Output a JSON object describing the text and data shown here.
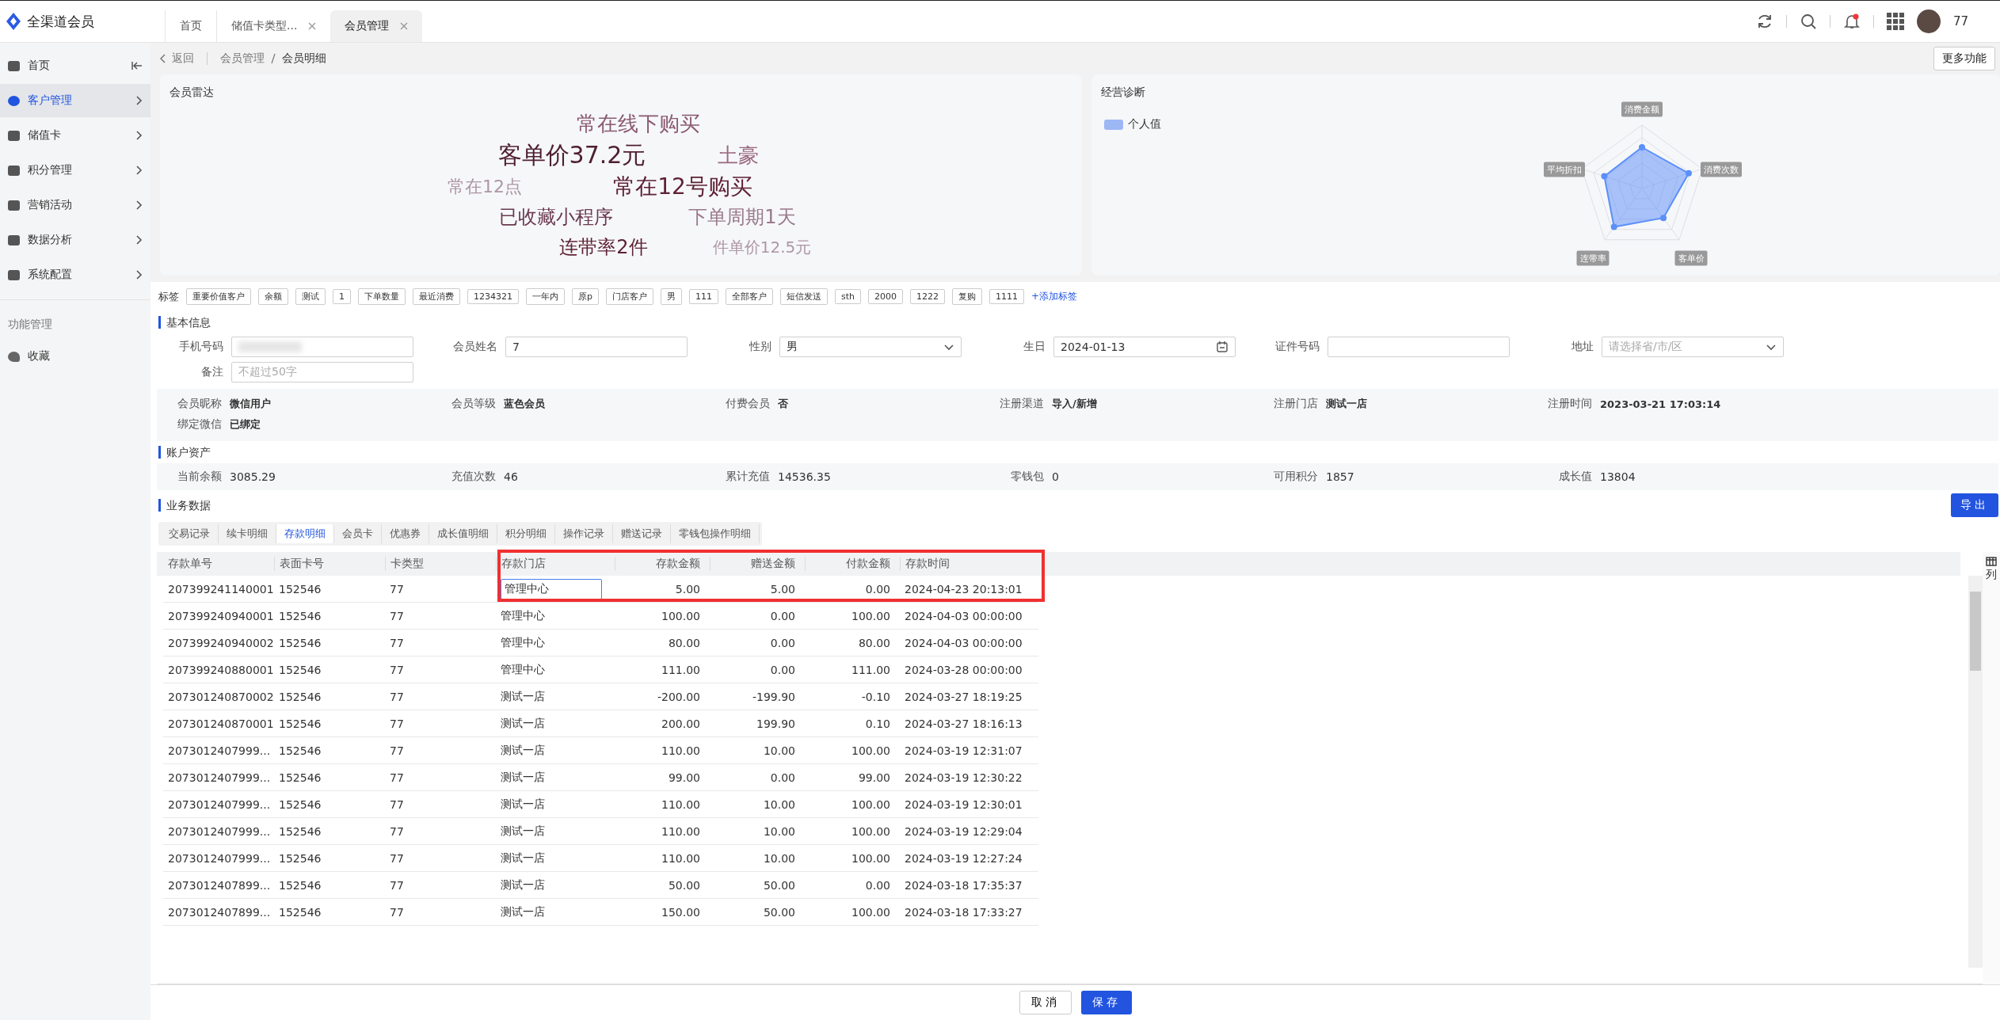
{
  "app": {
    "name": "全渠道会员"
  },
  "tabs": [
    {
      "label": "首页",
      "closable": false,
      "selected": false
    },
    {
      "label": "储值卡类型...",
      "closable": true,
      "selected": false
    },
    {
      "label": "会员管理",
      "closable": true,
      "selected": true
    }
  ],
  "header": {
    "user": "77",
    "notification": true
  },
  "sidebar": {
    "items": [
      {
        "label": "首页",
        "expandable": false,
        "selected": false
      },
      {
        "label": "客户管理",
        "expandable": true,
        "selected": true
      },
      {
        "label": "储值卡",
        "expandable": true,
        "selected": false
      },
      {
        "label": "积分管理",
        "expandable": true,
        "selected": false
      },
      {
        "label": "营销活动",
        "expandable": true,
        "selected": false
      },
      {
        "label": "数据分析",
        "expandable": true,
        "selected": false
      },
      {
        "label": "系统配置",
        "expandable": true,
        "selected": false
      }
    ],
    "section": "功能管理",
    "section_items": [
      {
        "label": "收藏",
        "selected": false
      }
    ]
  },
  "breadcrumb": {
    "back": "返回",
    "path": [
      "会员管理",
      "会员明细"
    ]
  },
  "more_button": "更多功能",
  "radar_card": {
    "title": "会员雷达",
    "words": [
      "常在线下购买",
      "客单价37.2元",
      "土豪",
      "常在12号购买",
      "常在12点",
      "已收藏小程序",
      "下单周期1天",
      "连带率2件",
      "件单价12.5元"
    ]
  },
  "diagnosis": {
    "title": "经营诊断",
    "legend": "个人值",
    "axes": [
      "消费金额",
      "消费次数",
      "客单价",
      "连带率",
      "平均折扣"
    ]
  },
  "tags": {
    "label": "标签",
    "items": [
      "重要价值客户",
      "余额",
      "测试",
      "1",
      "下单数量",
      "最近消费",
      "1234321",
      "一年内",
      "原p",
      "门店客户",
      "男",
      "111",
      "全部客户",
      "短信发送",
      "sth",
      "2000",
      "1222",
      "复购",
      "1111"
    ],
    "add": "+添加标签"
  },
  "basic_info": {
    "title": "基本信息",
    "fields": [
      {
        "label": "手机号码",
        "kind": "redacted"
      },
      {
        "label": "会员姓名",
        "kind": "text",
        "value": "7"
      },
      {
        "label": "性别",
        "kind": "select",
        "value": "男"
      },
      {
        "label": "生日",
        "kind": "date",
        "value": "2024-01-13"
      },
      {
        "label": "证件号码",
        "kind": "text"
      },
      {
        "label": "地址",
        "kind": "select",
        "placeholder": "请选择省/市/区"
      },
      {
        "label": "备注",
        "kind": "text",
        "placeholder": "不超过50字"
      }
    ],
    "details": [
      {
        "label": "会员昵称",
        "value": "微信用户"
      },
      {
        "label": "会员等级",
        "value": "蓝色会员"
      },
      {
        "label": "付费会员",
        "value": "否"
      },
      {
        "label": "注册渠道",
        "value": "导入/新增"
      },
      {
        "label": "注册门店",
        "value": "测试一店"
      },
      {
        "label": "注册时间",
        "value": "2023-03-21 17:03:14"
      },
      {
        "label": "绑定微信",
        "value": "已绑定"
      }
    ]
  },
  "assets": {
    "title": "账户资产",
    "items": [
      {
        "label": "当前余额",
        "value": "3085.29"
      },
      {
        "label": "充值次数",
        "value": "46"
      },
      {
        "label": "累计充值",
        "value": "14536.35"
      },
      {
        "label": "零钱包",
        "value": "0"
      },
      {
        "label": "可用积分",
        "value": "1857"
      },
      {
        "label": "成长值",
        "value": "13804"
      }
    ]
  },
  "business": {
    "title": "业务数据",
    "export": "导出",
    "tabs": [
      {
        "label": "交易记录",
        "selected": false
      },
      {
        "label": "续卡明细",
        "selected": false
      },
      {
        "label": "存款明细",
        "selected": true
      },
      {
        "label": "会员卡",
        "selected": false
      },
      {
        "label": "优惠券",
        "selected": false
      },
      {
        "label": "成长值明细",
        "selected": false
      },
      {
        "label": "积分明细",
        "selected": false
      },
      {
        "label": "操作记录",
        "selected": false
      },
      {
        "label": "赠送记录",
        "selected": false
      },
      {
        "label": "零钱包操作明细",
        "selected": false
      }
    ],
    "table": {
      "columns": [
        {
          "label": "存款单号",
          "kind": "text"
        },
        {
          "label": "表面卡号",
          "kind": "text"
        },
        {
          "label": "卡类型",
          "kind": "text"
        },
        {
          "label": "存款门店",
          "kind": "text"
        },
        {
          "label": "存款金额",
          "kind": "number"
        },
        {
          "label": "赠送金额",
          "kind": "number"
        },
        {
          "label": "付款金额",
          "kind": "number"
        },
        {
          "label": "存款时间",
          "kind": "text"
        }
      ],
      "highlighted": true,
      "rows": [
        {
          "editing": true,
          "cells": [
            "207399241140001",
            "152546",
            "77",
            "管理中心",
            "5.00",
            "5.00",
            "0.00",
            "2024-04-23 20:13:01"
          ]
        },
        {
          "editing": false,
          "cells": [
            "207399240940001",
            "152546",
            "77",
            "管理中心",
            "100.00",
            "0.00",
            "100.00",
            "2024-04-03 00:00:00"
          ]
        },
        {
          "editing": false,
          "cells": [
            "207399240940002",
            "152546",
            "77",
            "管理中心",
            "80.00",
            "0.00",
            "80.00",
            "2024-04-03 00:00:00"
          ]
        },
        {
          "editing": false,
          "cells": [
            "207399240880001",
            "152546",
            "77",
            "管理中心",
            "111.00",
            "0.00",
            "111.00",
            "2024-03-28 00:00:00"
          ]
        },
        {
          "editing": false,
          "cells": [
            "207301240870002",
            "152546",
            "77",
            "测试一店",
            "-200.00",
            "-199.90",
            "-0.10",
            "2024-03-27 18:19:25"
          ]
        },
        {
          "editing": false,
          "cells": [
            "207301240870001",
            "152546",
            "77",
            "测试一店",
            "200.00",
            "199.90",
            "0.10",
            "2024-03-27 18:16:13"
          ]
        },
        {
          "editing": false,
          "cells": [
            "2073012407999...",
            "152546",
            "77",
            "测试一店",
            "110.00",
            "10.00",
            "100.00",
            "2024-03-19 12:31:07"
          ]
        },
        {
          "editing": false,
          "cells": [
            "2073012407999...",
            "152546",
            "77",
            "测试一店",
            "99.00",
            "0.00",
            "99.00",
            "2024-03-19 12:30:22"
          ]
        },
        {
          "editing": false,
          "cells": [
            "2073012407999...",
            "152546",
            "77",
            "测试一店",
            "110.00",
            "10.00",
            "100.00",
            "2024-03-19 12:30:01"
          ]
        },
        {
          "editing": false,
          "cells": [
            "2073012407999...",
            "152546",
            "77",
            "测试一店",
            "110.00",
            "10.00",
            "100.00",
            "2024-03-19 12:29:04"
          ]
        },
        {
          "editing": false,
          "cells": [
            "2073012407999...",
            "152546",
            "77",
            "测试一店",
            "110.00",
            "10.00",
            "100.00",
            "2024-03-19 12:27:24"
          ]
        },
        {
          "editing": false,
          "cells": [
            "2073012407899...",
            "152546",
            "77",
            "测试一店",
            "50.00",
            "50.00",
            "0.00",
            "2024-03-18 17:35:37"
          ]
        },
        {
          "editing": false,
          "cells": [
            "2073012407899...",
            "152546",
            "77",
            "测试一店",
            "150.00",
            "50.00",
            "100.00",
            "2024-03-18 17:33:27"
          ]
        }
      ]
    },
    "column_settings": "列"
  },
  "footer": {
    "cancel": "取消",
    "save": "保存"
  }
}
